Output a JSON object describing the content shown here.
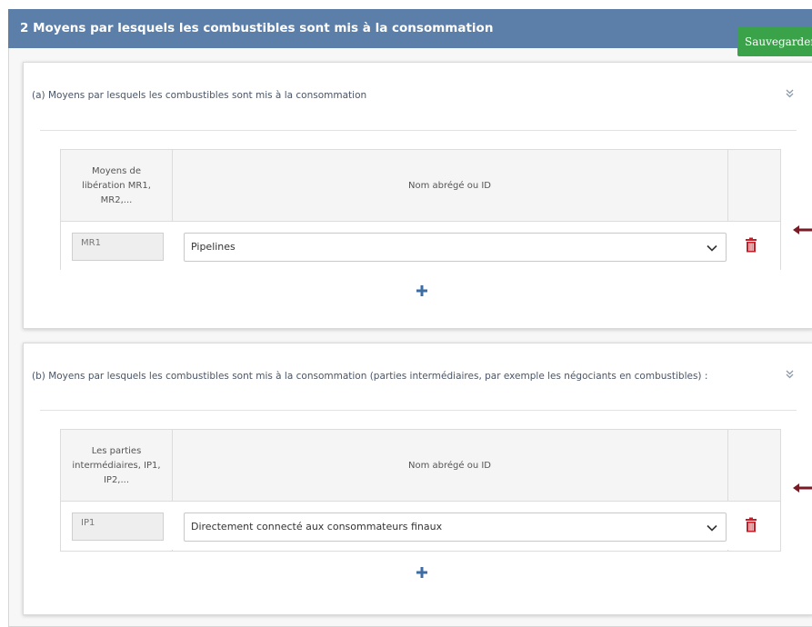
{
  "header": {
    "title": "2 Moyens par lesquels les combustibles sont mis à la consommation"
  },
  "toolbar": {
    "save_label": "Sauvegarder"
  },
  "colors": {
    "header_bg": "#5b7fa8",
    "save_bg": "#3aa34a",
    "delete": "#c0202a",
    "plus": "#3d6ea3",
    "arrow": "#7a1a25"
  },
  "sections": [
    {
      "title": "(a) Moyens par lesquels les combustibles sont mis à la consommation",
      "collapse_icon": "double-chevron-down-icon",
      "columns": [
        "Moyens de libération MR1, MR2,...",
        "Nom abrégé ou ID",
        ""
      ],
      "rows": [
        {
          "id": "MR1",
          "value": "Pipelines"
        }
      ]
    },
    {
      "title": "(b) Moyens par lesquels les combustibles sont mis à la consommation (parties intermédiaires, par exemple les négociants en combustibles) :",
      "collapse_icon": "double-chevron-down-icon",
      "columns": [
        "Les parties intermédiaires, IP1, IP2,...",
        "Nom abrégé ou ID",
        ""
      ],
      "rows": [
        {
          "id": "IP1",
          "value": "Directement connecté aux consommateurs finaux"
        }
      ]
    }
  ]
}
